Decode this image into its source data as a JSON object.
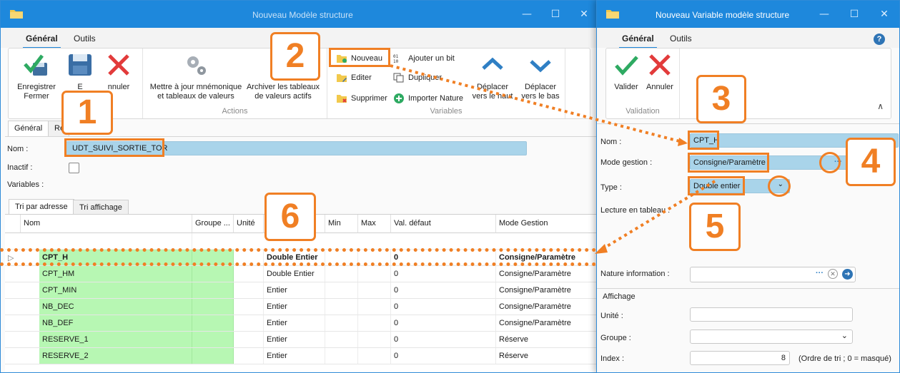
{
  "left_window": {
    "title": "Nouveau Modèle structure",
    "ribbon_tabs": [
      "Général",
      "Outils"
    ],
    "groups": {
      "file": {
        "save_close": "Enregistrer\nFermer",
        "save_partial": "E",
        "cancel_partial": "nnuler",
        "label_partial": "V"
      },
      "actions": {
        "update_mnemonic": "Mettre à jour mnémonique\net tableaux de valeurs",
        "archive_tables": "Archiver les tableaux\nde valeurs actifs",
        "label": "Actions"
      },
      "variables": {
        "new": "Nouveau",
        "edit": "Editer",
        "delete": "Supprimer",
        "add_bit": "Ajouter un bit",
        "duplicate": "Dupliquer",
        "import_nature": "Importer Nature",
        "move_up": "Déplacer\nvers le haut",
        "move_down": "Déplacer\nvers le bas",
        "label": "Variables"
      }
    },
    "form_tabs": [
      "Général",
      "Ré"
    ],
    "fields": {
      "name_label": "Nom :",
      "name_value": "UDT_SUIVI_SORTIE_TOR",
      "inactive_label": "Inactif :",
      "variables_label": "Variables :"
    },
    "sort_tabs": [
      "Tri par adresse",
      "Tri affichage"
    ],
    "grid": {
      "columns": [
        "Nom",
        "Groupe ...",
        "Unité",
        "",
        "Min",
        "Max",
        "Val. défaut",
        "Mode Gestion"
      ],
      "rows": [
        {
          "name": "CPT_H",
          "group": "",
          "unit": "",
          "type": "Double Entier",
          "min": "",
          "max": "",
          "default": "0",
          "mode": "Consigne/Paramètre",
          "bold": true,
          "marker": "▷"
        },
        {
          "name": "CPT_HM",
          "group": "",
          "unit": "",
          "type": "Double Entier",
          "min": "",
          "max": "",
          "default": "0",
          "mode": "Consigne/Paramètre"
        },
        {
          "name": "CPT_MIN",
          "group": "",
          "unit": "",
          "type": "Entier",
          "min": "",
          "max": "",
          "default": "0",
          "mode": "Consigne/Paramètre"
        },
        {
          "name": "NB_DEC",
          "group": "",
          "unit": "",
          "type": "Entier",
          "min": "",
          "max": "",
          "default": "0",
          "mode": "Consigne/Paramètre"
        },
        {
          "name": "NB_DEF",
          "group": "",
          "unit": "",
          "type": "Entier",
          "min": "",
          "max": "",
          "default": "0",
          "mode": "Consigne/Paramètre"
        },
        {
          "name": "RESERVE_1",
          "group": "",
          "unit": "",
          "type": "Entier",
          "min": "",
          "max": "",
          "default": "0",
          "mode": "Réserve"
        },
        {
          "name": "RESERVE_2",
          "group": "",
          "unit": "",
          "type": "Entier",
          "min": "",
          "max": "",
          "default": "0",
          "mode": "Réserve"
        }
      ]
    }
  },
  "right_window": {
    "title": "Nouveau Variable modèle structure",
    "ribbon_tabs": [
      "Général",
      "Outils"
    ],
    "help": "?",
    "buttons": {
      "validate": "Valider",
      "cancel": "Annuler",
      "group_label": "Validation"
    },
    "fields": {
      "name_label": "Nom :",
      "name_value": "CPT_H",
      "mode_label": "Mode gestion :",
      "mode_value": "Consigne/Paramètre",
      "type_label": "Type :",
      "type_value": "Double entier",
      "table_label": "Lecture en tableau :",
      "nature_label": "Nature information :",
      "display_section": "Affichage",
      "unit_label": "Unité :",
      "group_label": "Groupe :",
      "index_label": "Index :",
      "index_value": "8",
      "index_hint": "(Ordre de tri ; 0 = masqué)"
    }
  },
  "callouts": [
    "1",
    "2",
    "3",
    "4",
    "5",
    "6"
  ],
  "colors": {
    "titlebar": "#1e88dc",
    "accent": "#f07f24",
    "field_highlight": "#a9d4ea",
    "name_column": "#b7f7b3"
  }
}
